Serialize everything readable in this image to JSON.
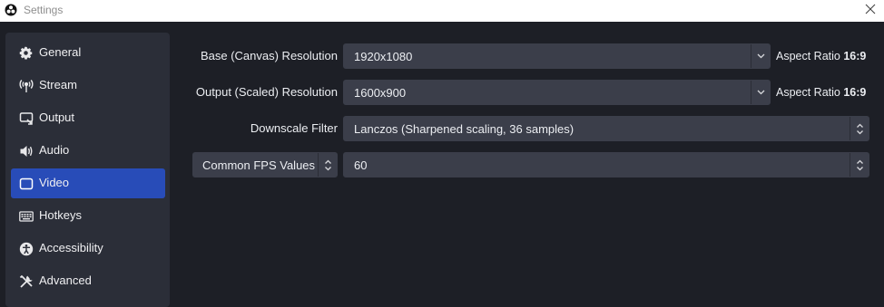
{
  "window": {
    "title": "Settings"
  },
  "sidebar": {
    "items": [
      {
        "label": "General",
        "icon": "gear-icon"
      },
      {
        "label": "Stream",
        "icon": "antenna-icon"
      },
      {
        "label": "Output",
        "icon": "output-icon"
      },
      {
        "label": "Audio",
        "icon": "speaker-icon"
      },
      {
        "label": "Video",
        "icon": "monitor-icon",
        "active": true
      },
      {
        "label": "Hotkeys",
        "icon": "keyboard-icon"
      },
      {
        "label": "Accessibility",
        "icon": "accessibility-icon"
      },
      {
        "label": "Advanced",
        "icon": "tools-icon"
      }
    ]
  },
  "video": {
    "base_resolution": {
      "label": "Base (Canvas) Resolution",
      "value": "1920x1080",
      "aspect_label": "Aspect Ratio",
      "aspect_value": "16:9"
    },
    "output_resolution": {
      "label": "Output (Scaled) Resolution",
      "value": "1600x900",
      "aspect_label": "Aspect Ratio",
      "aspect_value": "16:9"
    },
    "downscale_filter": {
      "label": "Downscale Filter",
      "value": "Lanczos (Sharpened scaling, 36 samples)"
    },
    "fps": {
      "type_value": "Common FPS Values",
      "value": "60"
    }
  },
  "colors": {
    "accent": "#284cb8",
    "background": "#1d1f26",
    "sidebar": "#2b2e38",
    "control": "#3b3e4a"
  }
}
